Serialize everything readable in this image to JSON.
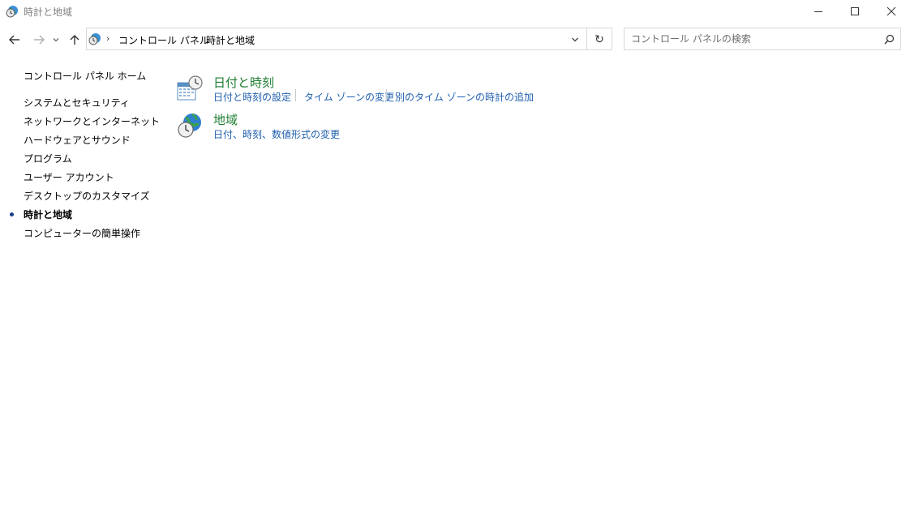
{
  "window": {
    "title": "時計と地域",
    "controls": {
      "minimize_icon": "minimize-icon",
      "maximize_icon": "maximize-icon",
      "close_icon": "close-icon"
    }
  },
  "navigation": {
    "back_icon": "back-arrow-icon",
    "forward_icon": "forward-arrow-icon",
    "recent_icon": "chevron-down-icon",
    "up_icon": "up-arrow-icon"
  },
  "address": {
    "breadcrumbs": [
      "コントロール パネル",
      "時計と地域"
    ],
    "separator": "›",
    "refresh_glyph": "↻"
  },
  "search": {
    "placeholder": "コントロール パネルの検索",
    "value": ""
  },
  "sidebar": {
    "home": "コントロール パネル ホーム",
    "items": [
      {
        "label": "システムとセキュリティ"
      },
      {
        "label": "ネットワークとインターネット"
      },
      {
        "label": "ハードウェアとサウンド"
      },
      {
        "label": "プログラム"
      },
      {
        "label": "ユーザー アカウント"
      },
      {
        "label": "デスクトップのカスタマイズ"
      },
      {
        "label": "時計と地域",
        "active": true
      },
      {
        "label": "コンピューターの簡単操作"
      }
    ]
  },
  "categories": [
    {
      "title": "日付と時刻",
      "icon": "calendar-clock-icon",
      "links": [
        "日付と時刻の設定",
        "タイム ゾーンの変更",
        "別のタイム ゾーンの時計の追加"
      ]
    },
    {
      "title": "地域",
      "icon": "globe-clock-icon",
      "links": [
        "日付、時刻、数値形式の変更"
      ]
    }
  ],
  "colors": {
    "category_title": "#1e7d32",
    "link": "#1f5fae",
    "bullet": "#1a3e8c"
  }
}
